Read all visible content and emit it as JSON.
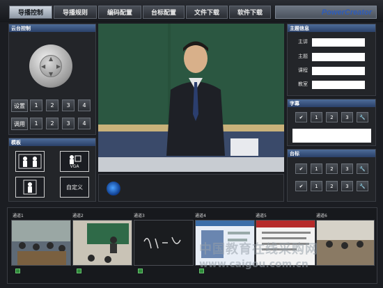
{
  "tabs": [
    {
      "label": "导播控制",
      "active": true
    },
    {
      "label": "导播规则",
      "active": false
    },
    {
      "label": "编码配置",
      "active": false
    },
    {
      "label": "台标配置",
      "active": false
    },
    {
      "label": "文件下载",
      "active": false
    },
    {
      "label": "软件下载",
      "active": false
    }
  ],
  "brand": "PowerCreator",
  "ptz": {
    "title": "云台控制",
    "preset_label": "设置",
    "recall_label": "调用",
    "preset_numbers": [
      "1",
      "2",
      "3",
      "4"
    ],
    "recall_numbers": [
      "1",
      "2",
      "3",
      "4"
    ]
  },
  "template": {
    "title": "模板",
    "vga_label": "VGA",
    "custom_label": "自定义"
  },
  "info": {
    "title": "主题信息",
    "fields": [
      {
        "label": "主讲",
        "value": ""
      },
      {
        "label": "主题",
        "value": ""
      },
      {
        "label": "课程",
        "value": ""
      },
      {
        "label": "教室",
        "value": ""
      }
    ]
  },
  "subtitle": {
    "title": "字幕",
    "numbers": [
      "1",
      "2",
      "3"
    ],
    "text": ""
  },
  "station_logo": {
    "title": "台标",
    "row1": [
      "1",
      "2",
      "3"
    ],
    "row2": [
      "1",
      "2",
      "3"
    ]
  },
  "channels": [
    {
      "label": "通道1"
    },
    {
      "label": "通道2"
    },
    {
      "label": "通道3"
    },
    {
      "label": "通道4"
    },
    {
      "label": "通道5"
    },
    {
      "label": "通道6"
    }
  ],
  "watermark": {
    "cn": "中国教育在线采购网",
    "url": "www.caigou.com.cn"
  },
  "colors": {
    "panel_header": "#3a5583",
    "active_tab": "#b7c0cc",
    "brand": "#2d5bb8"
  }
}
